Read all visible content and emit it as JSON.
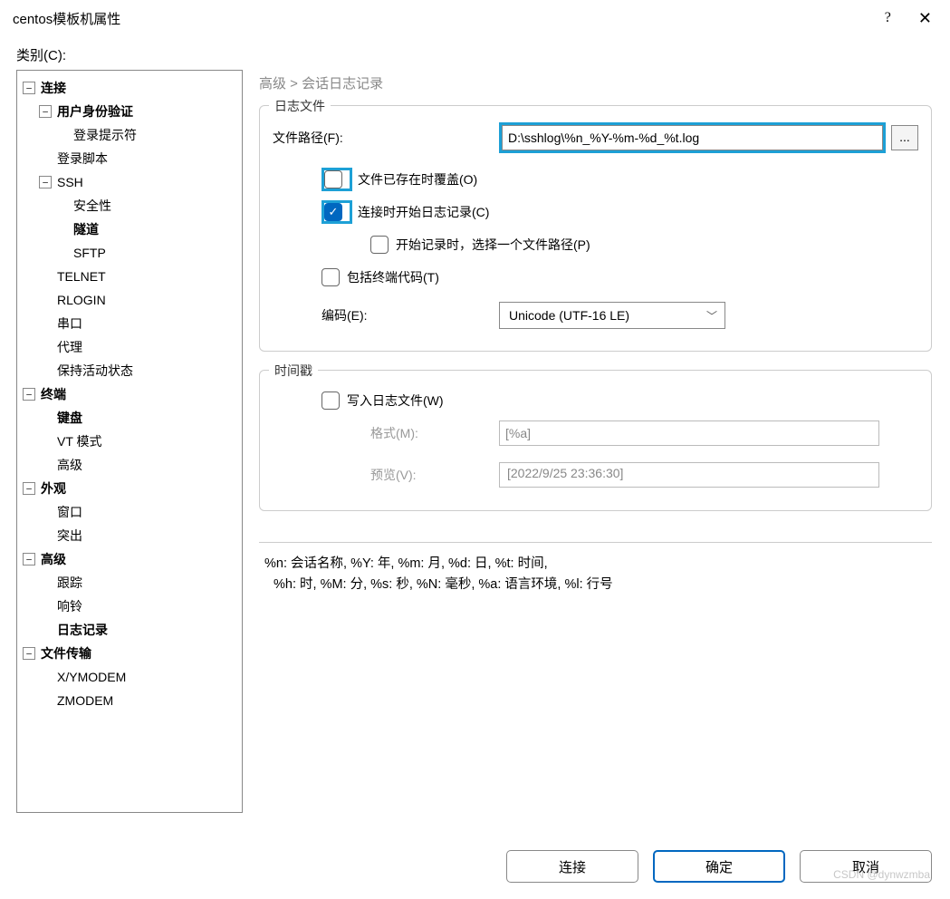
{
  "title": "centos模板机属性",
  "titlebar": {
    "help": "?",
    "close": "✕"
  },
  "category_label": "类别(C):",
  "tree": {
    "connection": "连接",
    "user_auth": "用户身份验证",
    "login_prompt": "登录提示符",
    "login_script": "登录脚本",
    "ssh": "SSH",
    "security": "安全性",
    "tunnel": "隧道",
    "sftp": "SFTP",
    "telnet": "TELNET",
    "rlogin": "RLOGIN",
    "serial": "串口",
    "proxy": "代理",
    "keepalive": "保持活动状态",
    "terminal": "终端",
    "keyboard": "键盘",
    "vt_mode": "VT 模式",
    "adv_term": "高级",
    "appearance": "外观",
    "window": "窗口",
    "highlight": "突出",
    "advanced": "高级",
    "trace": "跟踪",
    "bell": "响铃",
    "logging": "日志记录",
    "file_transfer": "文件传输",
    "xymodem": "X/YMODEM",
    "zmodem": "ZMODEM"
  },
  "breadcrumb": "高级  >  会话日志记录",
  "logfile": {
    "section": "日志文件",
    "path_label": "文件路径(F):",
    "path_value": "D:\\sshlog\\%n_%Y-%m-%d_%t.log",
    "browse": "...",
    "overwrite": "文件已存在时覆盖(O)",
    "start_on_connect": "连接时开始日志记录(C)",
    "ask_path": "开始记录时，选择一个文件路径(P)",
    "include_codes": "包括终端代码(T)",
    "encoding_label": "编码(E):",
    "encoding_value": "Unicode (UTF-16 LE)"
  },
  "timestamp": {
    "section": "时间戳",
    "write": "写入日志文件(W)",
    "format_label": "格式(M):",
    "format_value": "[%a]",
    "preview_label": "预览(V):",
    "preview_value": "[2022/9/25 23:36:30]"
  },
  "placeholders": {
    "line1": "%n: 会话名称, %Y: 年, %m: 月, %d: 日, %t: 时间,",
    "line2": "%h: 时, %M: 分, %s: 秒, %N: 毫秒, %a: 语言环境, %l: 行号"
  },
  "buttons": {
    "connect": "连接",
    "ok": "确定",
    "cancel": "取消"
  },
  "watermark": "CSDN @dynwzmba"
}
